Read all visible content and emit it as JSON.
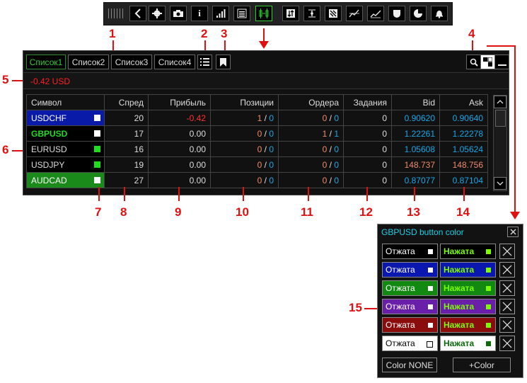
{
  "toolbar": {
    "icons": [
      "grip-icon",
      "back-arrow-icon",
      "gear-icon",
      "camera-icon",
      "info-icon",
      "signal-bars-icon",
      "list-icon",
      "candles-icon",
      "sort-icon",
      "level-icon",
      "pattern-icon",
      "trend-up-icon",
      "trend-line-icon",
      "shield-icon",
      "pie-chart-icon",
      "bell-icon"
    ],
    "info_glyph": "i"
  },
  "callouts": [
    "1",
    "2",
    "3",
    "4",
    "5",
    "6",
    "7",
    "8",
    "9",
    "10",
    "11",
    "12",
    "13",
    "14",
    "15"
  ],
  "tabs": [
    "Список1",
    "Список2",
    "Список3",
    "Список4"
  ],
  "balance": "-0.42 USD",
  "columns": [
    "Символ",
    "Спред",
    "Прибыль",
    "Позиции",
    "Ордера",
    "Задания",
    "Bid",
    "Ask"
  ],
  "rows": [
    {
      "symbol": "USDCHF",
      "spread": "20",
      "profit": "-0.42",
      "pos_a": "1",
      "pos_b": "0",
      "ord_a": "0",
      "ord_b": "0",
      "tasks": "0",
      "bid": "0.90620",
      "ask": "0.90640",
      "bg": "#0a1aa8",
      "sq": "#ffffff",
      "sym_color": "#ffffff"
    },
    {
      "symbol": "GBPUSD",
      "spread": "17",
      "profit": "0.00",
      "pos_a": "0",
      "pos_b": "0",
      "ord_a": "1",
      "ord_b": "1",
      "tasks": "0",
      "bid": "1.22261",
      "ask": "1.22278",
      "bg": "#000000",
      "sq": "#ffffff",
      "sym_color": "#1fdc1f"
    },
    {
      "symbol": "EURUSD",
      "spread": "16",
      "profit": "0.00",
      "pos_a": "0",
      "pos_b": "0",
      "ord_a": "0",
      "ord_b": "0",
      "tasks": "0",
      "bid": "1.05608",
      "ask": "1.05624",
      "bg": "#000000",
      "sq": "#1fdc1f",
      "sym_color": "#dddddd"
    },
    {
      "symbol": "USDJPY",
      "spread": "19",
      "profit": "0.00",
      "pos_a": "0",
      "pos_b": "0",
      "ord_a": "0",
      "ord_b": "0",
      "tasks": "0",
      "bid": "148.737",
      "ask": "148.756",
      "bg": "#000000",
      "sq": "#1fdc1f",
      "sym_color": "#dddddd"
    },
    {
      "symbol": "AUDCAD",
      "spread": "27",
      "profit": "0.00",
      "pos_a": "0",
      "pos_b": "0",
      "ord_a": "0",
      "ord_b": "0",
      "tasks": "0",
      "bid": "0.87077",
      "ask": "0.87104",
      "bg": "#1a8a1a",
      "sq": "#ffffff",
      "sym_color": "#ffffff"
    }
  ],
  "dialog": {
    "title": "GBPUSD button color",
    "released_label": "Отжата",
    "pressed_label": "Нажата",
    "rows": [
      {
        "rel_bg": "#000000",
        "rel_fg": "#ffffff",
        "rel_dot": "#ffffff",
        "pr_bg": "#000000",
        "pr_fg": "#7cfc00",
        "pr_dot": "#7cfc00"
      },
      {
        "rel_bg": "#0a18b0",
        "rel_fg": "#ffffff",
        "rel_dot": "#ffffff",
        "pr_bg": "#0a18b0",
        "pr_fg": "#7cfc00",
        "pr_dot": "#7cfc00"
      },
      {
        "rel_bg": "#128a12",
        "rel_fg": "#ffffff",
        "rel_dot": "#ffffff",
        "pr_bg": "#128a12",
        "pr_fg": "#7cfc00",
        "pr_dot": "#7cfc00"
      },
      {
        "rel_bg": "#6a1fa8",
        "rel_fg": "#ffffff",
        "rel_dot": "#ffffff",
        "pr_bg": "#6a1fa8",
        "pr_fg": "#7cfc00",
        "pr_dot": "#7cfc00"
      },
      {
        "rel_bg": "#8a0c0c",
        "rel_fg": "#ffffff",
        "rel_dot": "#ffffff",
        "pr_bg": "#8a0c0c",
        "pr_fg": "#7cfc00",
        "pr_dot": "#7cfc00"
      },
      {
        "rel_bg": "#ffffff",
        "rel_fg": "#000000",
        "rel_dot": "#ffffff",
        "pr_bg": "#ffffff",
        "pr_fg": "#0a6a0a",
        "pr_dot": "#0a6a0a"
      }
    ],
    "none_button": "Color NONE",
    "add_button": "+Color"
  }
}
